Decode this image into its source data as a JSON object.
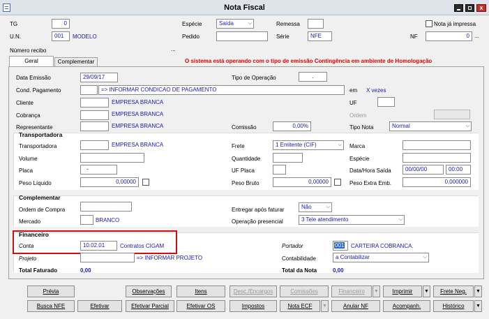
{
  "window": {
    "title": "Nota Fiscal"
  },
  "header": {
    "tg_label": "TG",
    "tg_value": "0",
    "un_label": "U.N.",
    "un_value": "001",
    "un_name": "MODELO",
    "especie_label": "Espécie",
    "especie_value": "Saída",
    "remessa_label": "Remessa",
    "pedido_label": "Pedido",
    "serie_label": "Série",
    "serie_value": "NFE",
    "nf_label": "NF",
    "nf_value": "0",
    "nota_ja_impressa_label": "Nota já impressa",
    "numero_recibo_label": "Número recibo",
    "ellipsis": "..."
  },
  "tabs": [
    {
      "label": "Geral"
    },
    {
      "label": "Complementar"
    }
  ],
  "warning": "O sistema está operando com o tipo de emissão Contingência em ambiente de Homologação",
  "geral": {
    "data_emissao_label": "Data Emissão",
    "data_emissao_value": "29/09/17",
    "tipo_operacao_label": "Tipo de Operação",
    "tipo_operacao_value": ".",
    "cond_pagamento_label": "Cond. Pagamento",
    "cond_pagamento_value": "=> INFORMAR CONDICAO DE PAGAMENTO",
    "em_label": "em",
    "x_vezes": "X vezes",
    "cliente_label": "Cliente",
    "cliente_value": "EMPRESA BRANCA",
    "uf_label": "UF",
    "cobranca_label": "Cobrança",
    "cobranca_value": "EMPRESA BRANCA",
    "ordem_label": "Ordem",
    "representante_label": "Representante",
    "representante_value": "EMPRESA BRANCA",
    "comissao_label": "Comissão",
    "comissao_value": "0,00%",
    "tipo_nota_label": "Tipo Nota",
    "tipo_nota_value": "Normal"
  },
  "transportadora": {
    "title": "Transportadora",
    "transportadora_label": "Transportadora",
    "transportadora_value": "EMPRESA BRANCA",
    "frete_label": "Frete",
    "frete_value": "1 Emitente (CIF)",
    "marca_label": "Marca",
    "volume_label": "Volume",
    "quantidade_label": "Quantidade",
    "especie_label": "Espécie",
    "placa_label": "Placa",
    "placa_value": "-",
    "uf_placa_label": "UF Placa",
    "data_hora_saida_label": "Data/Hora Saída",
    "data_saida_value": "00/00/00",
    "hora_saida_value": "00:00",
    "peso_liquido_label": "Peso Líquido",
    "peso_liquido_value": "0,00000",
    "peso_bruto_label": "Peso Bruto",
    "peso_bruto_value": "0,00000",
    "peso_extra_label": "Peso Extra Emb.",
    "peso_extra_value": "0,000000"
  },
  "complementar": {
    "title": "Complementar",
    "ordem_compra_label": "Ordem de Compra",
    "entregar_apos_label": "Entregar após faturar",
    "entregar_apos_value": "Não",
    "mercado_label": "Mercado",
    "mercado_value": "BRANCO",
    "operacao_presencial_label": "Operação presencial",
    "operacao_presencial_value": "3 Tele atendimento"
  },
  "financeiro": {
    "title": "Financeiro",
    "conta_label": "Conta",
    "conta_value": "10.02.01",
    "conta_name": "Contratos CIGAM",
    "portador_label": "Portador",
    "portador_value": "001",
    "portador_name": "CARTEIRA COBRANCA.",
    "projeto_label": "Projeto",
    "projeto_value": "=> INFORMAR PROJETO",
    "contabilidade_label": "Contabilidade",
    "contabilidade_value": "a Contabilizar",
    "total_faturado_label": "Total Faturado",
    "total_faturado_value": "0,00",
    "total_nota_label": "Total da Nota",
    "total_nota_value": "0,00"
  },
  "buttons_row1": {
    "previa": "Prévia",
    "observacoes": "Observações",
    "itens": "Itens",
    "desc_encargos": "Desc./Encargos",
    "comissoes": "Comissões",
    "financeiro": "Financeiro",
    "imprimir": "Imprimir",
    "frete_neg": "Frete Neg."
  },
  "buttons_row2": {
    "busca_nfe": "Busca NFE",
    "efetivar": "Efetivar",
    "efetivar_parcial": "Efetivar Parcial",
    "efetivar_os": "Efetivar OS",
    "impostos": "Impostos",
    "nota_ecf": "Nota ECF",
    "anular_nf": "Anular NF",
    "acompanh": "Acompanh.",
    "historico": "Histórico"
  },
  "colors": {
    "title_bar": "#d7dbe5",
    "accent_blue": "#1a1aa8",
    "warning_red": "#e00000",
    "highlight_border": "#d01010"
  },
  "icons": {
    "app": "document-icon",
    "minimize": "minimize-icon",
    "maximize": "maximize-icon",
    "close": "close-icon"
  }
}
